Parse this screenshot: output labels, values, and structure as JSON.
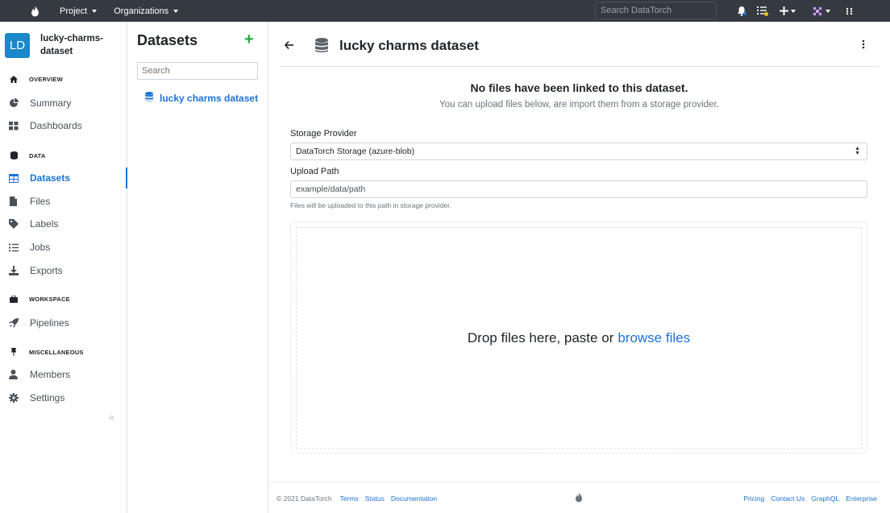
{
  "topbar": {
    "project_menu": "Project",
    "organizations_menu": "Organizations",
    "search_placeholder": "Search DataTorch"
  },
  "project": {
    "initials": "LD",
    "name": "lucky-charms-dataset"
  },
  "sidebar": {
    "sections": {
      "overview": "OVERVIEW",
      "data": "DATA",
      "workspace": "WORKSPACE",
      "misc": "MISCELLANEOUS"
    },
    "items": [
      {
        "label": "Summary",
        "icon": "pie-chart-icon"
      },
      {
        "label": "Dashboards",
        "icon": "grid-icon"
      },
      {
        "label": "Datasets",
        "icon": "table-icon",
        "active": true
      },
      {
        "label": "Files",
        "icon": "file-icon"
      },
      {
        "label": "Labels",
        "icon": "tag-icon"
      },
      {
        "label": "Jobs",
        "icon": "list-check-icon"
      },
      {
        "label": "Exports",
        "icon": "download-icon"
      },
      {
        "label": "Pipelines",
        "icon": "rocket-icon"
      },
      {
        "label": "Members",
        "icon": "user-icon"
      },
      {
        "label": "Settings",
        "icon": "gear-icon"
      }
    ]
  },
  "datasets": {
    "title": "Datasets",
    "search_placeholder": "Search",
    "items": [
      "lucky charms dataset"
    ]
  },
  "main": {
    "title": "lucky charms dataset",
    "empty_title": "No files have been linked to this dataset.",
    "empty_subtitle": "You can upload files below, are import them from a storage provider.",
    "storage_label": "Storage Provider",
    "storage_value": "DataTorch Storage (azure-blob)",
    "upload_label": "Upload Path",
    "upload_value": "example/data/path",
    "upload_help": "Files will be uploaded to this path in storage provider.",
    "drop_text": "Drop files here, paste or",
    "browse_text": "browse files"
  },
  "footer": {
    "copyright": "© 2021 DataTorch",
    "left_links": [
      "Terms",
      "Status",
      "Documentation"
    ],
    "right_links": [
      "Pricing",
      "Contact Us",
      "GraphQL",
      "Enterprise"
    ]
  },
  "colors": {
    "navbar": "#343a40",
    "accent": "#1a73d9",
    "add_green": "#28a745",
    "avatar": "#1a88c9"
  }
}
